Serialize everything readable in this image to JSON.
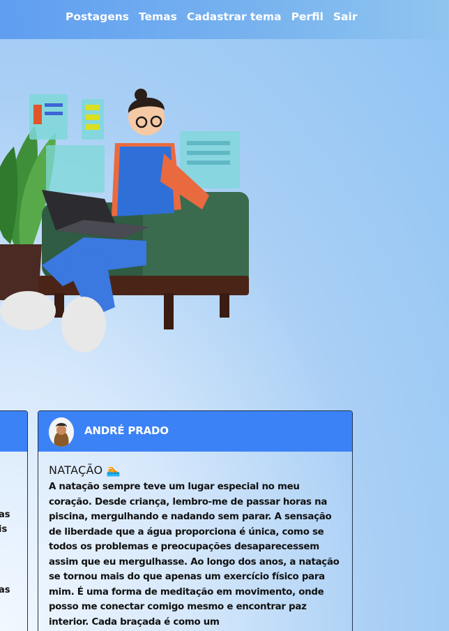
{
  "navbar": {
    "links": [
      "Postagens",
      "Temas",
      "Cadastrar tema",
      "Perfil",
      "Sair"
    ]
  },
  "colors": {
    "accent": "#3b82f6",
    "navbar": "#6fa8ef",
    "text": "#111111"
  },
  "hero": {
    "icon": "person-on-armchair-with-laptop-illustration"
  },
  "left_card": {
    "fragments": [
      "as",
      "is",
      "as"
    ]
  },
  "post": {
    "author": "ANDRÉ PRADO",
    "title": "NATAÇÃO 🏊",
    "text": "A natação sempre teve um lugar especial no meu coração. Desde criança, lembro-me de passar horas na piscina, mergulhando e nadando sem parar. A sensação de liberdade que a água proporciona é única, como se todos os problemas e preocupações desaparecessem assim que eu mergulhasse. Ao longo dos anos, a natação se tornou mais do que apenas um exercício físico para mim. É uma forma de meditação em movimento, onde posso me conectar comigo mesmo e encontrar paz interior. Cada braçada é como um"
  }
}
